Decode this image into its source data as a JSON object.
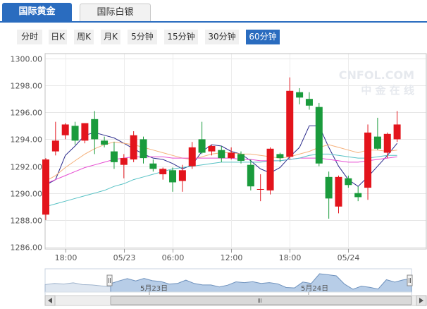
{
  "tabs": [
    {
      "label": "国际黄金",
      "active": true
    },
    {
      "label": "国际白银",
      "active": false
    }
  ],
  "periods": [
    {
      "label": "分时",
      "active": false
    },
    {
      "label": "日K",
      "active": false
    },
    {
      "label": "周K",
      "active": false
    },
    {
      "label": "月K",
      "active": false
    },
    {
      "label": "5分钟",
      "active": false
    },
    {
      "label": "15分钟",
      "active": false
    },
    {
      "label": "30分钟",
      "active": false
    },
    {
      "label": "60分钟",
      "active": true
    }
  ],
  "watermark": {
    "top": "CNFOL.COM",
    "bottom": "中 金 在 线"
  },
  "navigator": {
    "labels": [
      "5月23日",
      "5月24日"
    ]
  },
  "colors": {
    "up": "#e3141c",
    "down": "#1a9b3c",
    "accent": "#2a6cbf",
    "ma5": "#2b2b8c",
    "ma10": "#f5b07a",
    "ma20": "#e64bd2",
    "ma30": "#55c1c4"
  },
  "chart_data": {
    "type": "candlestick",
    "ylim": [
      1286,
      1300
    ],
    "yticks": [
      "1300.00",
      "1298.00",
      "1296.00",
      "1294.00",
      "1292.00",
      "1290.00",
      "1288.00",
      "1286.00"
    ],
    "xticks": [
      "18:00",
      "05/23",
      "06:00",
      "12:00",
      "18:00",
      "05/24"
    ],
    "grid": true,
    "candles": [
      {
        "o": 1288.4,
        "h": 1292.6,
        "l": 1288.0,
        "c": 1292.5
      },
      {
        "o": 1293.1,
        "h": 1295.3,
        "l": 1292.8,
        "c": 1293.9
      },
      {
        "o": 1294.3,
        "h": 1295.2,
        "l": 1294.0,
        "c": 1295.1
      },
      {
        "o": 1295.0,
        "h": 1295.3,
        "l": 1293.6,
        "c": 1293.9
      },
      {
        "o": 1293.9,
        "h": 1295.2,
        "l": 1293.7,
        "c": 1295.2
      },
      {
        "o": 1295.5,
        "h": 1296.1,
        "l": 1292.9,
        "c": 1294.0
      },
      {
        "o": 1293.9,
        "h": 1294.2,
        "l": 1293.4,
        "c": 1293.6
      },
      {
        "o": 1293.1,
        "h": 1293.8,
        "l": 1291.8,
        "c": 1292.3
      },
      {
        "o": 1292.1,
        "h": 1292.9,
        "l": 1291.1,
        "c": 1292.6
      },
      {
        "o": 1292.5,
        "h": 1294.6,
        "l": 1292.3,
        "c": 1294.3
      },
      {
        "o": 1294.0,
        "h": 1294.2,
        "l": 1292.2,
        "c": 1292.6
      },
      {
        "o": 1292.2,
        "h": 1292.5,
        "l": 1291.6,
        "c": 1291.8
      },
      {
        "o": 1291.4,
        "h": 1291.9,
        "l": 1291.0,
        "c": 1291.8
      },
      {
        "o": 1291.7,
        "h": 1291.9,
        "l": 1290.1,
        "c": 1290.8
      },
      {
        "o": 1290.9,
        "h": 1292.1,
        "l": 1290.1,
        "c": 1291.7
      },
      {
        "o": 1292.0,
        "h": 1293.8,
        "l": 1291.8,
        "c": 1293.4
      },
      {
        "o": 1294.0,
        "h": 1295.3,
        "l": 1292.9,
        "c": 1293.0
      },
      {
        "o": 1293.1,
        "h": 1293.6,
        "l": 1292.8,
        "c": 1293.5
      },
      {
        "o": 1293.2,
        "h": 1293.5,
        "l": 1292.3,
        "c": 1292.6
      },
      {
        "o": 1292.6,
        "h": 1293.4,
        "l": 1292.5,
        "c": 1293.0
      },
      {
        "o": 1292.9,
        "h": 1293.1,
        "l": 1292.2,
        "c": 1292.4
      },
      {
        "o": 1292.1,
        "h": 1292.5,
        "l": 1290.2,
        "c": 1290.5
      },
      {
        "o": 1290.3,
        "h": 1291.4,
        "l": 1289.4,
        "c": 1290.3
      },
      {
        "o": 1290.2,
        "h": 1293.4,
        "l": 1289.9,
        "c": 1293.3
      },
      {
        "o": 1292.9,
        "h": 1293.0,
        "l": 1292.3,
        "c": 1292.6
      },
      {
        "o": 1292.7,
        "h": 1298.6,
        "l": 1292.5,
        "c": 1297.6
      },
      {
        "o": 1297.5,
        "h": 1297.8,
        "l": 1296.6,
        "c": 1297.1
      },
      {
        "o": 1297.0,
        "h": 1297.5,
        "l": 1296.2,
        "c": 1296.5
      },
      {
        "o": 1296.4,
        "h": 1296.7,
        "l": 1292.0,
        "c": 1292.2
      },
      {
        "o": 1291.2,
        "h": 1291.6,
        "l": 1288.1,
        "c": 1289.6
      },
      {
        "o": 1289.0,
        "h": 1291.3,
        "l": 1288.5,
        "c": 1291.2
      },
      {
        "o": 1291.1,
        "h": 1291.3,
        "l": 1290.4,
        "c": 1290.6
      },
      {
        "o": 1290.0,
        "h": 1290.5,
        "l": 1289.4,
        "c": 1289.7
      },
      {
        "o": 1290.4,
        "h": 1295.1,
        "l": 1289.5,
        "c": 1294.5
      },
      {
        "o": 1294.2,
        "h": 1295.6,
        "l": 1293.2,
        "c": 1293.3
      },
      {
        "o": 1293.0,
        "h": 1294.5,
        "l": 1292.6,
        "c": 1294.4
      },
      {
        "o": 1294.0,
        "h": 1296.1,
        "l": 1293.8,
        "c": 1295.1
      }
    ],
    "ma_lines": [
      {
        "key": "ma5",
        "values": [
          1290.6,
          1291.0,
          1292.8,
          1293.5,
          1294.3,
          1294.5,
          1294.3,
          1294.1,
          1293.7,
          1293.3,
          1292.9,
          1292.6,
          1292.5,
          1292.2,
          1291.8,
          1292.1,
          1293.1,
          1293.6,
          1293.5,
          1293.1,
          1292.9,
          1292.4,
          1291.8,
          1291.5,
          1291.9,
          1292.7,
          1293.4,
          1295.0,
          1295.0,
          1293.4,
          1292.0,
          1291.0,
          1290.5,
          1291.2,
          1292.0,
          1292.8,
          1293.7
        ]
      },
      {
        "key": "ma10",
        "values": [
          1290.9,
          1291.3,
          1291.9,
          1292.4,
          1292.9,
          1293.3,
          1293.6,
          1293.8,
          1293.7,
          1293.6,
          1293.4,
          1293.2,
          1293.0,
          1292.8,
          1292.6,
          1292.5,
          1292.7,
          1292.9,
          1293.0,
          1293.0,
          1292.9,
          1292.9,
          1292.8,
          1292.7,
          1292.6,
          1292.7,
          1292.9,
          1293.1,
          1293.4,
          1293.6,
          1293.4,
          1293.2,
          1293.0,
          1293.2,
          1293.2,
          1293.1,
          1293.2
        ]
      },
      {
        "key": "ma20",
        "values": [
          1290.7,
          1291.0,
          1291.3,
          1291.6,
          1291.9,
          1292.1,
          1292.3,
          1292.5,
          1292.6,
          1292.7,
          1292.7,
          1292.7,
          1292.7,
          1292.6,
          1292.6,
          1292.6,
          1292.6,
          1292.6,
          1292.6,
          1292.6,
          1292.5,
          1292.5,
          1292.4,
          1292.4,
          1292.4,
          1292.5,
          1292.6,
          1292.6,
          1292.6,
          1292.5,
          1292.4,
          1292.3,
          1292.3,
          1292.4,
          1292.5,
          1292.6,
          1292.7
        ]
      },
      {
        "key": "ma30",
        "values": [
          1289.0,
          1289.2,
          1289.4,
          1289.6,
          1289.8,
          1290.0,
          1290.2,
          1290.5,
          1290.7,
          1291.0,
          1291.2,
          1291.4,
          1291.6,
          1291.8,
          1291.9,
          1292.0,
          1292.1,
          1292.2,
          1292.3,
          1292.3,
          1292.3,
          1292.3,
          1292.3,
          1292.4,
          1292.4,
          1292.5,
          1292.6,
          1292.8,
          1292.9,
          1292.9,
          1292.8,
          1292.7,
          1292.6,
          1292.6,
          1292.7,
          1292.8,
          1292.8
        ]
      }
    ]
  }
}
